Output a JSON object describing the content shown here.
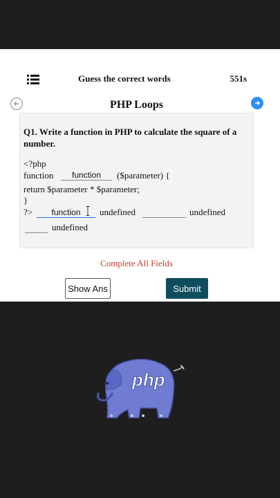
{
  "header": {
    "title": "Guess the correct words",
    "timer": "551s"
  },
  "nav": {
    "topic": "PHP Loops"
  },
  "question": {
    "text": "Q1. Write a function in PHP to calculate the square of a number.",
    "code": {
      "line1": "<?php",
      "line2_before": "function",
      "blank1_value": "function",
      "line2_after": "($parameter) {",
      "line3": "return $parameter * $parameter;",
      "line4": "}",
      "line5_before": "?>",
      "blank2_value": "function",
      "line5_mid": "undefined",
      "blank3_value": "",
      "line5_after": "undefined",
      "blank4_value": "",
      "line6": "undefined"
    }
  },
  "warning": "Complete All Fields",
  "buttons": {
    "show_answer": "Show Ans",
    "submit": "Submit"
  },
  "logo": {
    "text": "php"
  },
  "colors": {
    "background": "#1e1e1e",
    "submit_bg": "#0e4d5e",
    "warning": "#c0392b",
    "next_button": "#2d8ff0",
    "logo_elephant": "#6f7cd1"
  }
}
